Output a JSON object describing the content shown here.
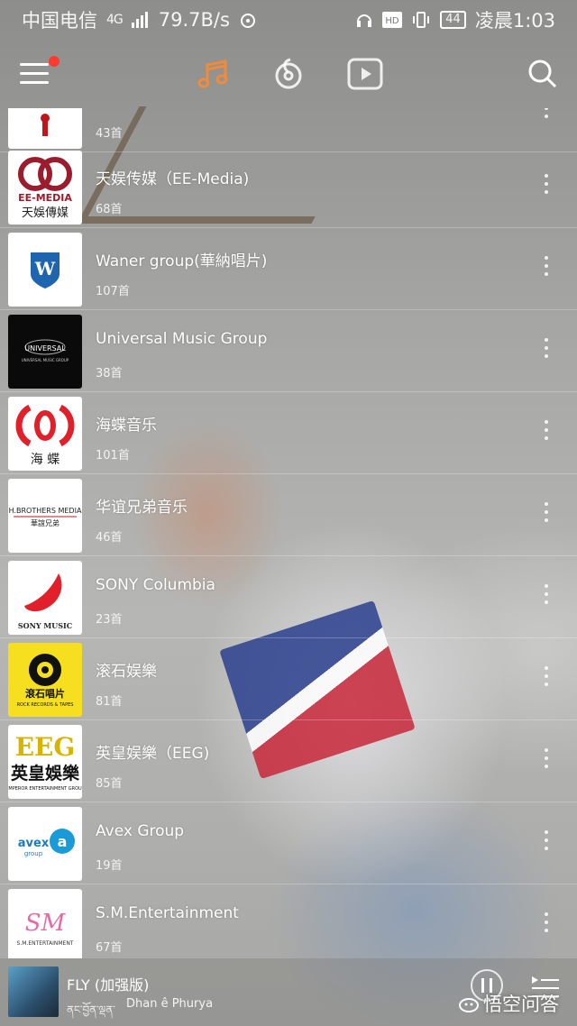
{
  "status_bar": {
    "carrier": "中国电信",
    "network": "4G",
    "speed": "79.7B/s",
    "battery": "44",
    "time": "凌晨1:03"
  },
  "nav": {
    "tabs": [
      {
        "icon": "music-note-icon",
        "active": true
      },
      {
        "icon": "netease-logo-icon",
        "active": false
      },
      {
        "icon": "video-play-icon",
        "active": false
      }
    ],
    "accent_color": "#f08a3c"
  },
  "list": {
    "items": [
      {
        "title": "",
        "count": "43首",
        "logo": "partial-logo"
      },
      {
        "title": "天娱传媒（EE-Media)",
        "count": "68首",
        "logo": "EE-MEDIA 天娛傳媒"
      },
      {
        "title": "Waner group(華納唱片)",
        "count": "107首",
        "logo": "warner-logo"
      },
      {
        "title": "Universal Music Group",
        "count": "38首",
        "logo": "UNIVERSAL"
      },
      {
        "title": "海蝶音乐",
        "count": "101首",
        "logo": "海 蝶"
      },
      {
        "title": "华谊兄弟音乐",
        "count": "46首",
        "logo": "H.BROTHERS MEDIA 華誼兄弟"
      },
      {
        "title": "SONY Columbia",
        "count": "23首",
        "logo": "SONY MUSIC"
      },
      {
        "title": "滚石娱樂",
        "count": "81首",
        "logo": "滾石唱片"
      },
      {
        "title": "英皇娱樂（EEG)",
        "count": "85首",
        "logo": "EEG 英皇娛樂"
      },
      {
        "title": "Avex Group",
        "count": "19首",
        "logo": "avex group"
      },
      {
        "title": "S.M.Entertainment",
        "count": "67首",
        "logo": "SM ENTERTAINMENT"
      }
    ]
  },
  "player": {
    "title": "FLY (加强版)",
    "subtitle": "ནང་བྱོན་ལྡན་",
    "artist": "Dhan ê  Phurya"
  },
  "watermark": "悟空问答"
}
